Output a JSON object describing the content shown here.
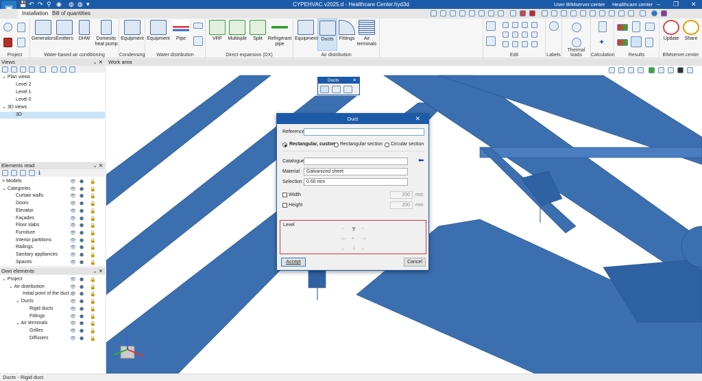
{
  "window": {
    "title": "CYPEHVAC v2025.d - Healthcare Center.hyd3d",
    "user": "User BIMserver.center",
    "project": "Healthcare center",
    "minimize": "–",
    "restore": "❐",
    "close": "✕"
  },
  "tabs": [
    "Installation",
    "Bill of quantities"
  ],
  "ribbon": {
    "groups": [
      "Project",
      "Water-based air conditioning",
      "Condensing",
      "Water distribution",
      "Direct expansion (DX)",
      "Air distribution",
      "Edit",
      "Labels",
      "Thermal loads",
      "Calculation",
      "Results",
      "BIMserver.center"
    ],
    "buttons": {
      "generators": "Generators",
      "emitters": "Emitters",
      "dhw": "DHW",
      "heat_pump": "Domestic heat pump",
      "cond_equipment": "Equipment",
      "water_equipment": "Equipment",
      "pipe": "Pipe",
      "vrf": "VRF",
      "multisplit": "Multisplit",
      "split": "Split",
      "refrigerant": "Refrigerant pipe",
      "air_equipment": "Equipment",
      "ducts": "Ducts",
      "fittings": "Fittings",
      "air_terminals": "Air terminals",
      "update": "Update",
      "share": "Share"
    }
  },
  "views": {
    "title": "Views",
    "items": [
      "Plan views",
      "Level 2",
      "Level 1",
      "Level 0",
      "3D views",
      "3D"
    ]
  },
  "elements_read": {
    "title": "Elements read",
    "items": [
      "Models",
      "Categories",
      "Curtain walls",
      "Doors",
      "Elevator",
      "Façades",
      "Floor slabs",
      "Furniture",
      "Interior partitions",
      "Railings",
      "Sanitary appliances",
      "Spaces"
    ]
  },
  "own_elements": {
    "title": "Own elements",
    "items": [
      "Project",
      "Air distribution",
      "Initial point of the duct ...",
      "Ducts",
      "Rigid ducts",
      "Fittings",
      "Air terminals",
      "Grilles",
      "Diffusers"
    ]
  },
  "work_area": {
    "title": "Work area"
  },
  "ducts_toolbar": {
    "title": "Ducts"
  },
  "dialog": {
    "title": "Duct",
    "reference_label": "Reference",
    "reference_value": "",
    "options": [
      "Rectangular, custom",
      "Rectangular section",
      "Circular section"
    ],
    "catalogue_label": "Catalogue",
    "catalogue_value": "",
    "material_label": "Material",
    "material_value": "Galvanized sheet",
    "selection_label": "Selection",
    "selection_value": "0.60 mm",
    "width_label": "Width",
    "width_value": "200",
    "height_label": "Height",
    "height_value": "200",
    "unit": "mm",
    "level_label": "Level",
    "accept": "Accept",
    "cancel": "Cancel"
  },
  "status": "Ducts - Rigid duct",
  "colors": {
    "accent": "#1b5aa6",
    "duct": "#3b6fb0",
    "highlight": "#d9343f"
  }
}
